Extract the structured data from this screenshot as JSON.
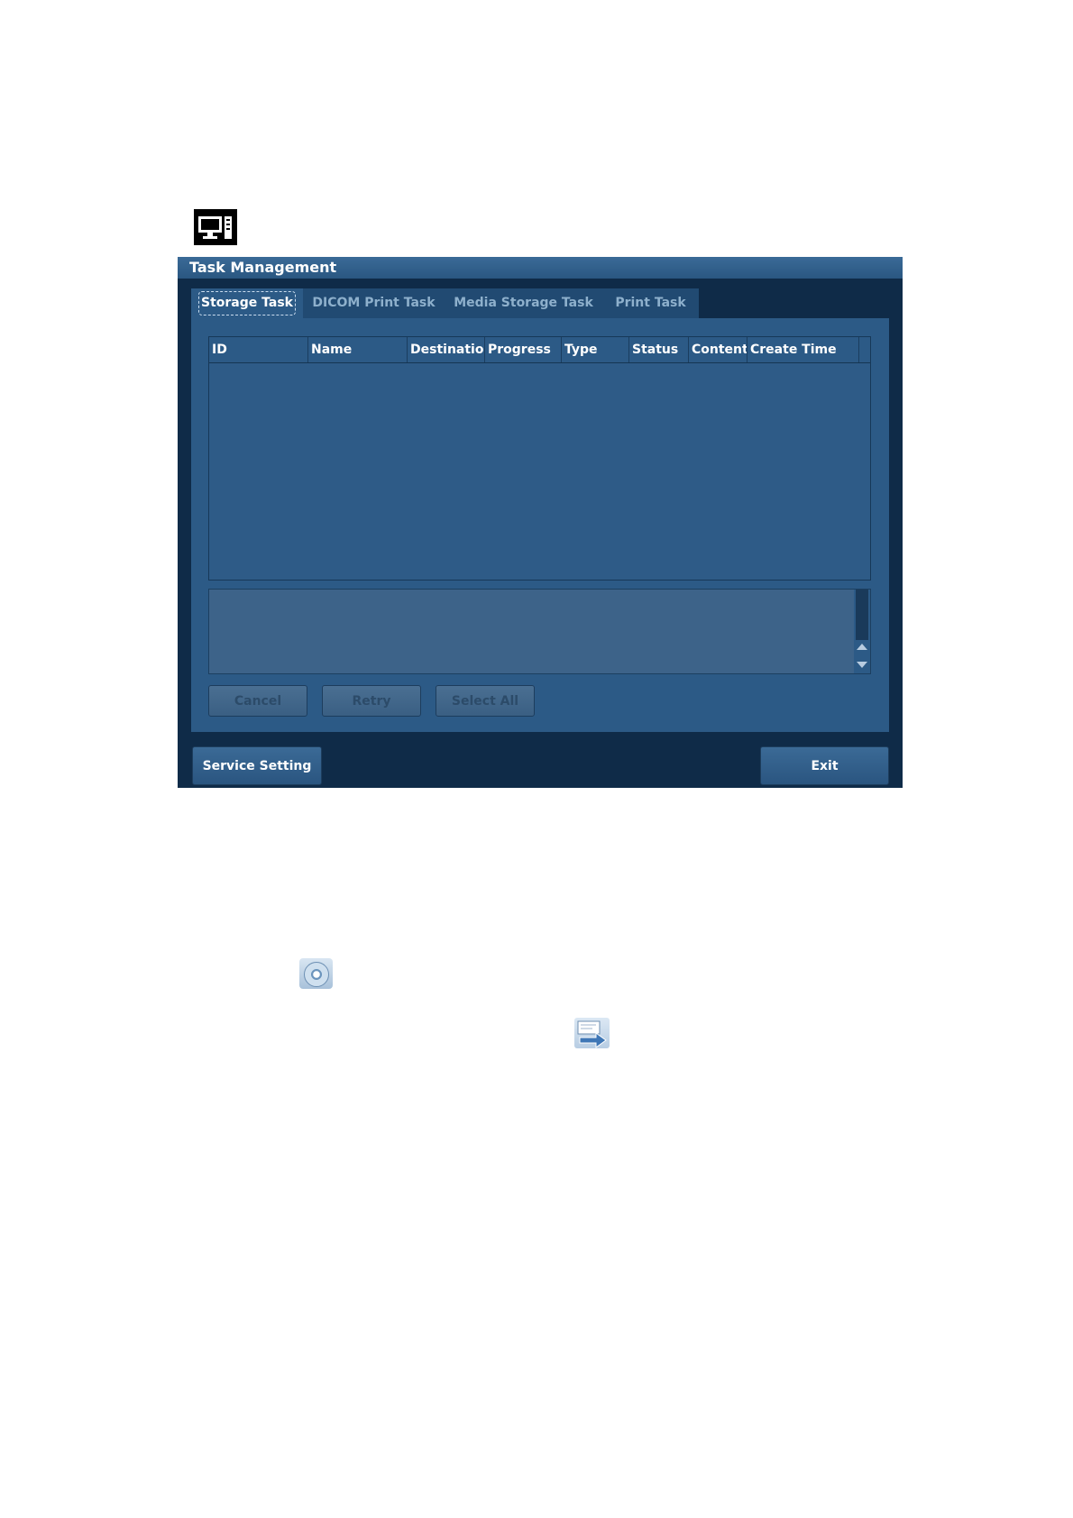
{
  "top_icon": "computer-monitor-icon",
  "dialog": {
    "title": "Task Management",
    "tabs": [
      {
        "label": "Storage Task",
        "active": true
      },
      {
        "label": "DICOM Print Task",
        "active": false
      },
      {
        "label": "Media Storage Task",
        "active": false
      },
      {
        "label": "Print Task",
        "active": false
      }
    ],
    "table": {
      "columns": [
        "ID",
        "Name",
        "Destination",
        "Progress",
        "Type",
        "Status",
        "Content",
        "Create Time"
      ],
      "rows": []
    },
    "buttons": {
      "cancel": "Cancel",
      "retry": "Retry",
      "select_all": "Select All",
      "service_setting": "Service Setting",
      "exit": "Exit"
    }
  },
  "lower_icons": [
    "disc-icon",
    "send-arrow-icon"
  ],
  "colors": {
    "dialog_bg": "#0f2b48",
    "panel_bg": "#2c5a86",
    "title_bar": "#2a5781",
    "disabled_text": "#2c4b69"
  }
}
